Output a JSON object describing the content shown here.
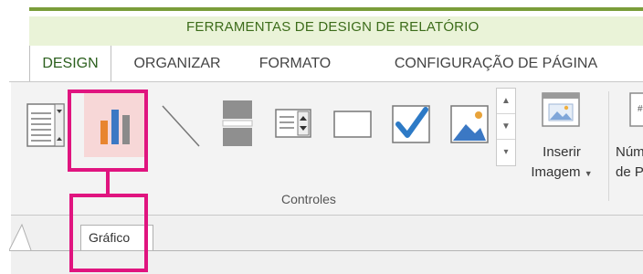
{
  "context": {
    "title": "FERRAMENTAS DE DESIGN DE RELATÓRIO"
  },
  "tabs": [
    {
      "label": "DESIGN",
      "active": true
    },
    {
      "label": "ORGANIZAR",
      "active": false
    },
    {
      "label": "FORMATO",
      "active": false
    },
    {
      "label": "CONFIGURAÇÃO DE PÁGINA",
      "active": false
    }
  ],
  "ribbon": {
    "controls_gallery": {
      "items": [
        "list-box-icon",
        "chart-icon",
        "line-icon",
        "split-rectangle-icon",
        "combo-box-icon",
        "rectangle-icon",
        "checkbox-icon",
        "image-icon"
      ],
      "selected": "chart-icon"
    },
    "group_label": "Controles",
    "insert_image": {
      "line1": "Inserir",
      "line2": "Imagem"
    },
    "page_number": {
      "line1": "Núm",
      "line2": "de P"
    }
  },
  "document": {
    "tab_label": "Gráfico"
  },
  "colors": {
    "highlight": "#e0147f",
    "context_green": "#7a9d3a",
    "context_bg": "#eaf3d8",
    "chart_bar_orange": "#e8852f",
    "chart_bar_blue": "#3b78c4",
    "check_blue": "#2d7ac6"
  }
}
